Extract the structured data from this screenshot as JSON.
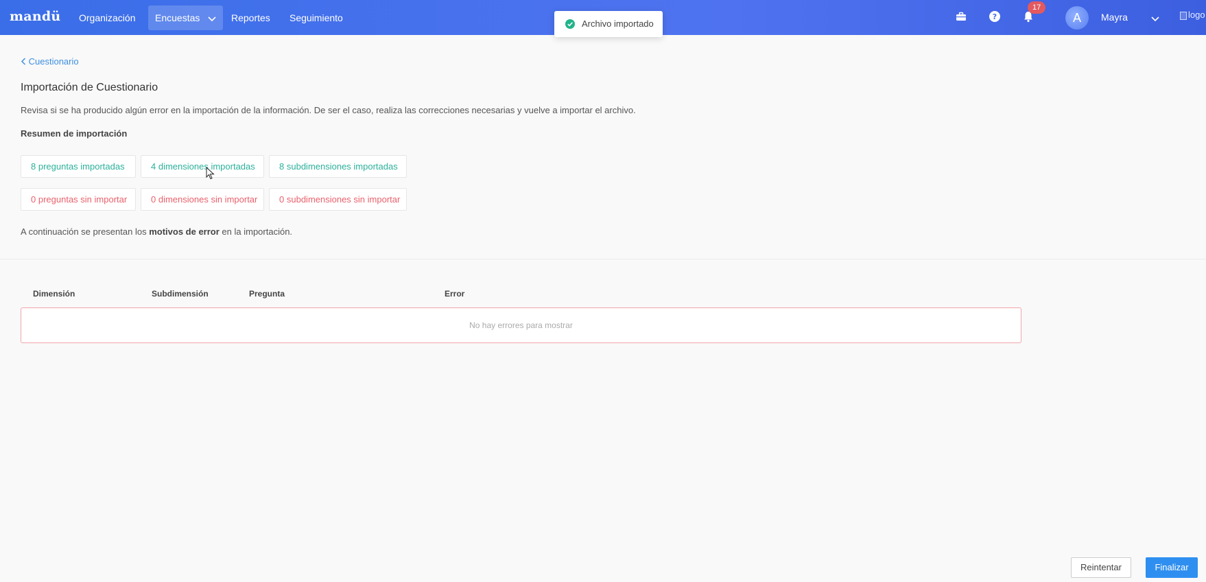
{
  "nav": {
    "logo": "mandü",
    "items": [
      {
        "label": "Organización",
        "active": false
      },
      {
        "label": "Encuestas",
        "active": true
      },
      {
        "label": "Reportes",
        "active": false
      },
      {
        "label": "Seguimiento",
        "active": false
      }
    ],
    "notification_count": "17",
    "user": {
      "initial": "A",
      "name": "Mayra"
    },
    "logo_alt": "logo",
    "icons": [
      "briefcase-icon",
      "help-icon",
      "bell-icon",
      "chevron-down-icon"
    ]
  },
  "toast": {
    "message": "Archivo importado",
    "icon": "check-circle-icon"
  },
  "breadcrumb": {
    "label": "Cuestionario"
  },
  "page": {
    "title": "Importación de Cuestionario",
    "description": "Revisa si se ha producido algún error en la importación de la información. De ser el caso, realiza las correcciones necesarias y vuelve a importar el archivo.",
    "summary_heading": "Resumen de importación",
    "imported": [
      {
        "count": "8",
        "label": "preguntas importadas"
      },
      {
        "count": "4",
        "label": "dimensiones importadas"
      },
      {
        "count": "8",
        "label": "subdimensiones importadas"
      }
    ],
    "not_imported": [
      {
        "count": "0",
        "label": "preguntas sin importar"
      },
      {
        "count": "0",
        "label": "dimensiones sin importar"
      },
      {
        "count": "0",
        "label": "subdimensiones sin importar"
      }
    ],
    "reasons_prefix": "A continuación se presentan los",
    "reasons_bold": "motivos de error",
    "reasons_suffix": "en la importación."
  },
  "table": {
    "headers": [
      "Dimensión",
      "Subdimensión",
      "Pregunta",
      "Error"
    ],
    "empty_message": "No hay errores para mostrar"
  },
  "actions": {
    "retry": "Reintentar",
    "finish": "Finalizar"
  },
  "colors": {
    "nav_start": "#3a6ee8",
    "success": "#2bb09a",
    "error": "#e8616c",
    "link": "#3d8fe0",
    "primary_button": "#2f8ff0"
  }
}
